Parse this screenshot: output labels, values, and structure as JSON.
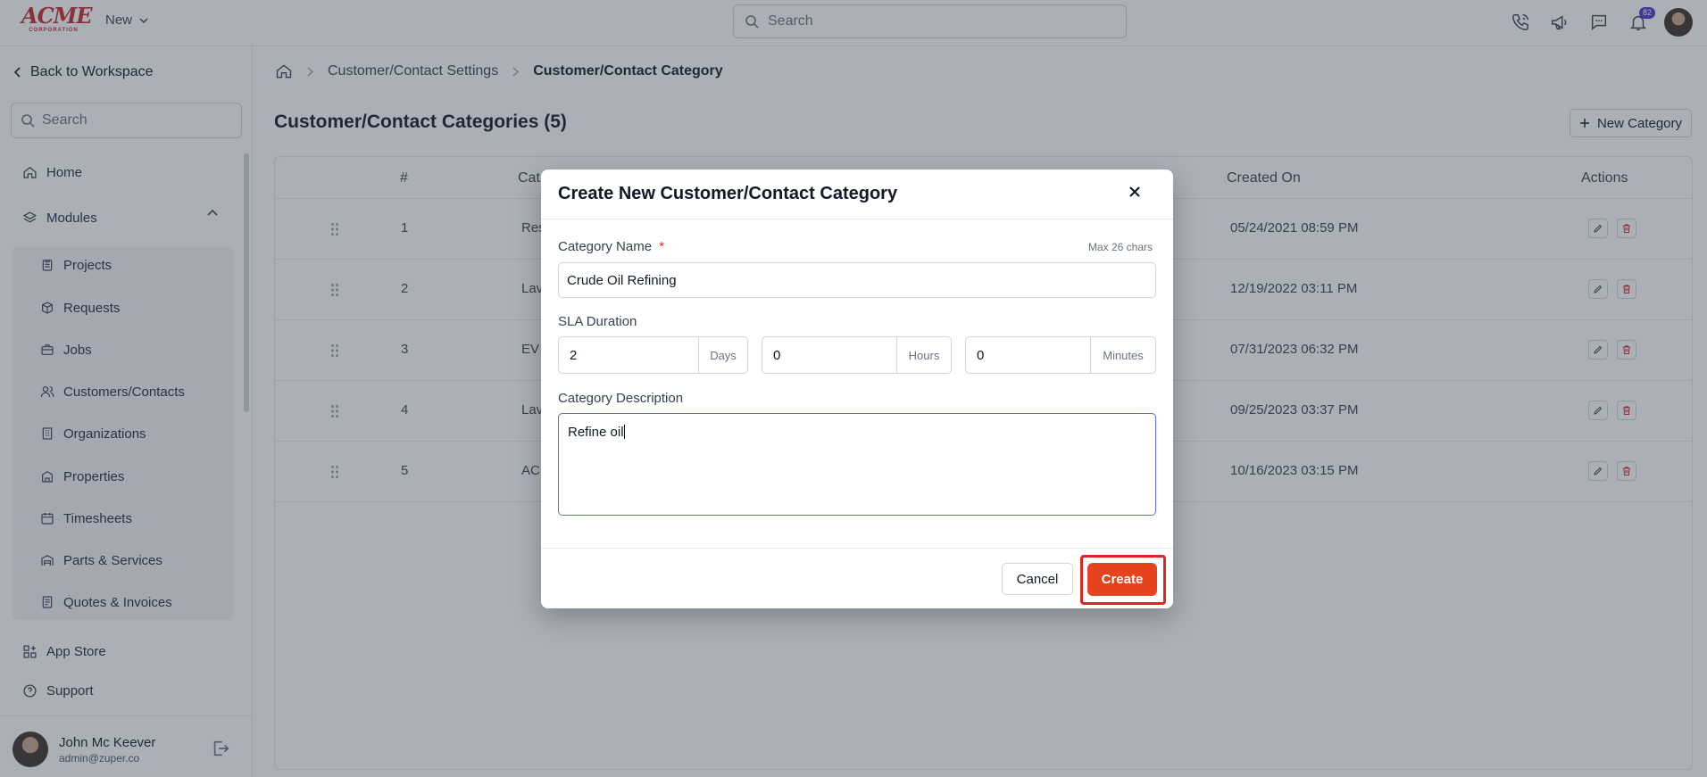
{
  "topbar": {
    "logo_text": "ACME",
    "logo_sub": "CORPORATION",
    "new_label": "New",
    "search_placeholder": "Search",
    "notification_count": "82"
  },
  "sidebar": {
    "back_label": "Back to Workspace",
    "search_placeholder": "Search",
    "home_label": "Home",
    "modules_label": "Modules",
    "modules": [
      {
        "label": "Projects",
        "icon": "clipboard-icon"
      },
      {
        "label": "Requests",
        "icon": "box-icon"
      },
      {
        "label": "Jobs",
        "icon": "briefcase-icon"
      },
      {
        "label": "Customers/Contacts",
        "icon": "users-icon"
      },
      {
        "label": "Organizations",
        "icon": "building-icon"
      },
      {
        "label": "Properties",
        "icon": "property-icon"
      },
      {
        "label": "Timesheets",
        "icon": "calendar-icon"
      },
      {
        "label": "Parts & Services",
        "icon": "warehouse-icon"
      },
      {
        "label": "Quotes & Invoices",
        "icon": "document-icon"
      }
    ],
    "app_store_label": "App Store",
    "support_label": "Support",
    "user": {
      "name": "John Mc Keever",
      "email": "admin@zuper.co"
    }
  },
  "main": {
    "breadcrumb": [
      "Customer/Contact Settings",
      "Customer/Contact Category"
    ],
    "title": "Customer/Contact Categories (5)",
    "new_category_label": "New Category",
    "table": {
      "headers": {
        "num": "#",
        "category": "Cat",
        "created_on": "Created On",
        "actions": "Actions"
      },
      "rows": [
        {
          "num": "1",
          "cat": "Res",
          "date": "05/24/2021 08:59 PM"
        },
        {
          "num": "2",
          "cat": "Lav",
          "date": "12/19/2022 03:11 PM"
        },
        {
          "num": "3",
          "cat": "EV",
          "date": "07/31/2023 06:32 PM"
        },
        {
          "num": "4",
          "cat": "Lav",
          "date": "09/25/2023 03:37 PM"
        },
        {
          "num": "5",
          "cat": "AC",
          "date": "10/16/2023 03:15 PM"
        }
      ]
    }
  },
  "modal": {
    "title": "Create New Customer/Contact Category",
    "category_name_label": "Category Name",
    "required_mark": "*",
    "max_chars": "Max 26 chars",
    "category_name_value": "Crude Oil Refining",
    "sla_label": "SLA Duration",
    "sla": {
      "days_value": "2",
      "days_unit": "Days",
      "hours_value": "0",
      "hours_unit": "Hours",
      "minutes_value": "0",
      "minutes_unit": "Minutes"
    },
    "description_label": "Category Description",
    "description_value": "Refine oil",
    "cancel_label": "Cancel",
    "create_label": "Create"
  },
  "colors": {
    "accent": "#e5431c",
    "highlight": "#dc2626",
    "focus": "#6366f1",
    "delete": "#dc2626",
    "badge": "#4338ca"
  }
}
